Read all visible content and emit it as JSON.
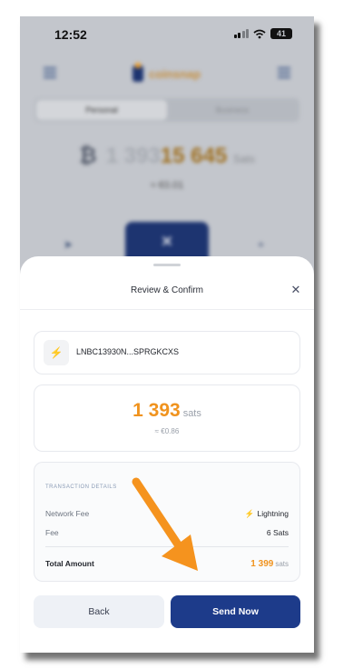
{
  "status_bar": {
    "time": "12:52",
    "battery": "41"
  },
  "app": {
    "logo_text": "coinsnap"
  },
  "tabs": [
    {
      "label": "Personal"
    },
    {
      "label": "Business"
    }
  ],
  "balance": {
    "prefix": "1 393",
    "amount": "15 645",
    "unit": "Sats",
    "fiat": "≈ €0.01"
  },
  "sheet": {
    "title": "Review & Confirm",
    "invoice": "LNBC13930N...SPRGKCXS",
    "amount": {
      "value": "1 393",
      "unit": "sats",
      "fiat": "≈ €0.86"
    },
    "details": {
      "title": "TRANSACTION DETAILS",
      "network_fee_label": "Network Fee",
      "network_fee_value": "Lightning",
      "fee_label": "Fee",
      "fee_value": "6 Sats",
      "total_label": "Total Amount",
      "total_value": "1 399",
      "total_unit": "sats"
    },
    "buttons": {
      "back": "Back",
      "send": "Send Now"
    }
  },
  "colors": {
    "accent": "#f0931e",
    "primary": "#1d3b8a",
    "arrow": "#f5931e"
  }
}
